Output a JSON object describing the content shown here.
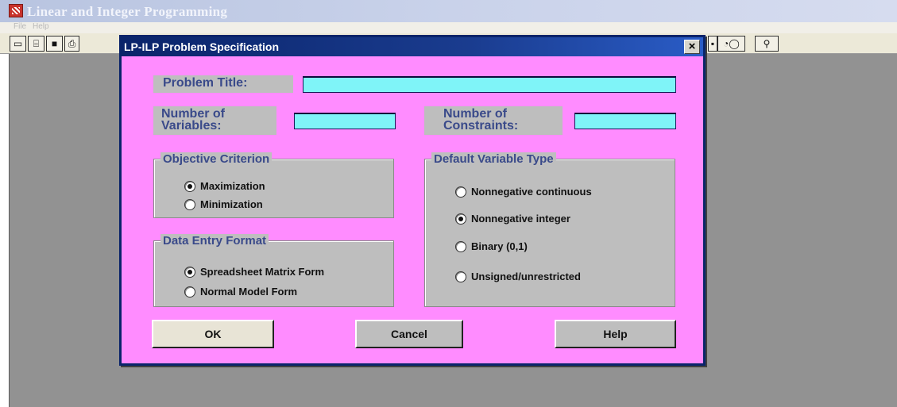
{
  "app": {
    "title": "Linear and Integer Programming",
    "menu": [
      "File",
      "Help"
    ],
    "toolbar_left_icons": [
      "new-icon",
      "open-icon",
      "save-icon",
      "print-icon"
    ],
    "toolbar_right_icons": [
      "toolbar-button-icon",
      "chart-icon",
      "help-pointer-icon"
    ]
  },
  "dialog": {
    "title": "LP-ILP Problem Specification",
    "close_label": "×",
    "problem_title_label": "Problem Title:",
    "problem_title_value": "",
    "num_variables_label": "Number of Variables:",
    "num_variables_value": "",
    "num_constraints_label": "Number of Constraints:",
    "num_constraints_value": "",
    "objective_group": {
      "legend": "Objective Criterion",
      "options": [
        {
          "label": "Maximization",
          "selected": true
        },
        {
          "label": "Minimization",
          "selected": false
        }
      ]
    },
    "data_entry_group": {
      "legend": "Data Entry Format",
      "options": [
        {
          "label": "Spreadsheet Matrix Form",
          "selected": true
        },
        {
          "label": "Normal Model Form",
          "selected": false
        }
      ]
    },
    "variable_type_group": {
      "legend": "Default Variable Type",
      "options": [
        {
          "label": "Nonnegative continuous",
          "selected": false
        },
        {
          "label": "Nonnegative integer",
          "selected": true
        },
        {
          "label": "Binary (0,1)",
          "selected": false
        },
        {
          "label": "Unsigned/unrestricted",
          "selected": false
        }
      ]
    },
    "buttons": {
      "ok": "OK",
      "cancel": "Cancel",
      "help": "Help"
    }
  },
  "colors": {
    "dialog_background": "#ff8cff",
    "field_background": "#7ff4f8",
    "title_bar": "#0a246a",
    "workspace": "#929292"
  }
}
